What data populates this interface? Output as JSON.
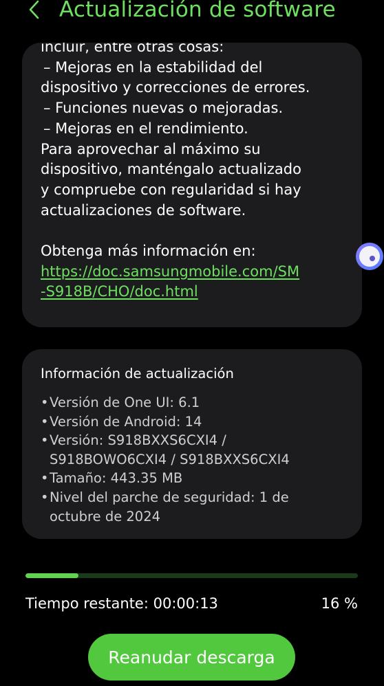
{
  "header": {
    "title": "Actualización de software",
    "back_icon": "chevron-left-icon"
  },
  "release_notes": {
    "lines": [
      "incluir, entre otras cosas:",
      " – Mejoras en la estabilidad del",
      "dispositivo y correcciones de errores.",
      " – Funciones nuevas o mejoradas.",
      " – Mejoras en el rendimiento.",
      "Para aprovechar al máximo su",
      "dispositivo, manténgalo actualizado",
      "y compruebe con regularidad si hay",
      "actualizaciones de software."
    ],
    "more_info_label": "Obtenga más información en:",
    "link_lines": [
      "https://doc.samsungmobile.com/SM",
      "-S918B/CHO/doc.html"
    ]
  },
  "update_info": {
    "title": "Información de actualización",
    "items": [
      {
        "line1": "Versión de One UI: 6.1",
        "line2": ""
      },
      {
        "line1": "Versión de Android: 14",
        "line2": ""
      },
      {
        "line1": "Versión: S918BXXS6CXI4 /",
        "line2": "S918BOWO6CXI4 / S918BXXS6CXI4"
      },
      {
        "line1": "Tamaño: 443.35 MB",
        "line2": ""
      },
      {
        "line1": "Nivel del parche de seguridad: 1 de",
        "line2": "octubre de 2024"
      }
    ]
  },
  "download": {
    "progress_percent": 16,
    "time_remaining": "Tiempo restante: 00:00:13",
    "percent_label": "16 %"
  },
  "actions": {
    "resume_label": "Reanudar descarga"
  },
  "colors": {
    "accent": "#6ee060",
    "button": "#52c83e",
    "card": "#1c1c1e",
    "background": "#000000"
  },
  "floating": {
    "icon": "floating-assistant-icon"
  }
}
